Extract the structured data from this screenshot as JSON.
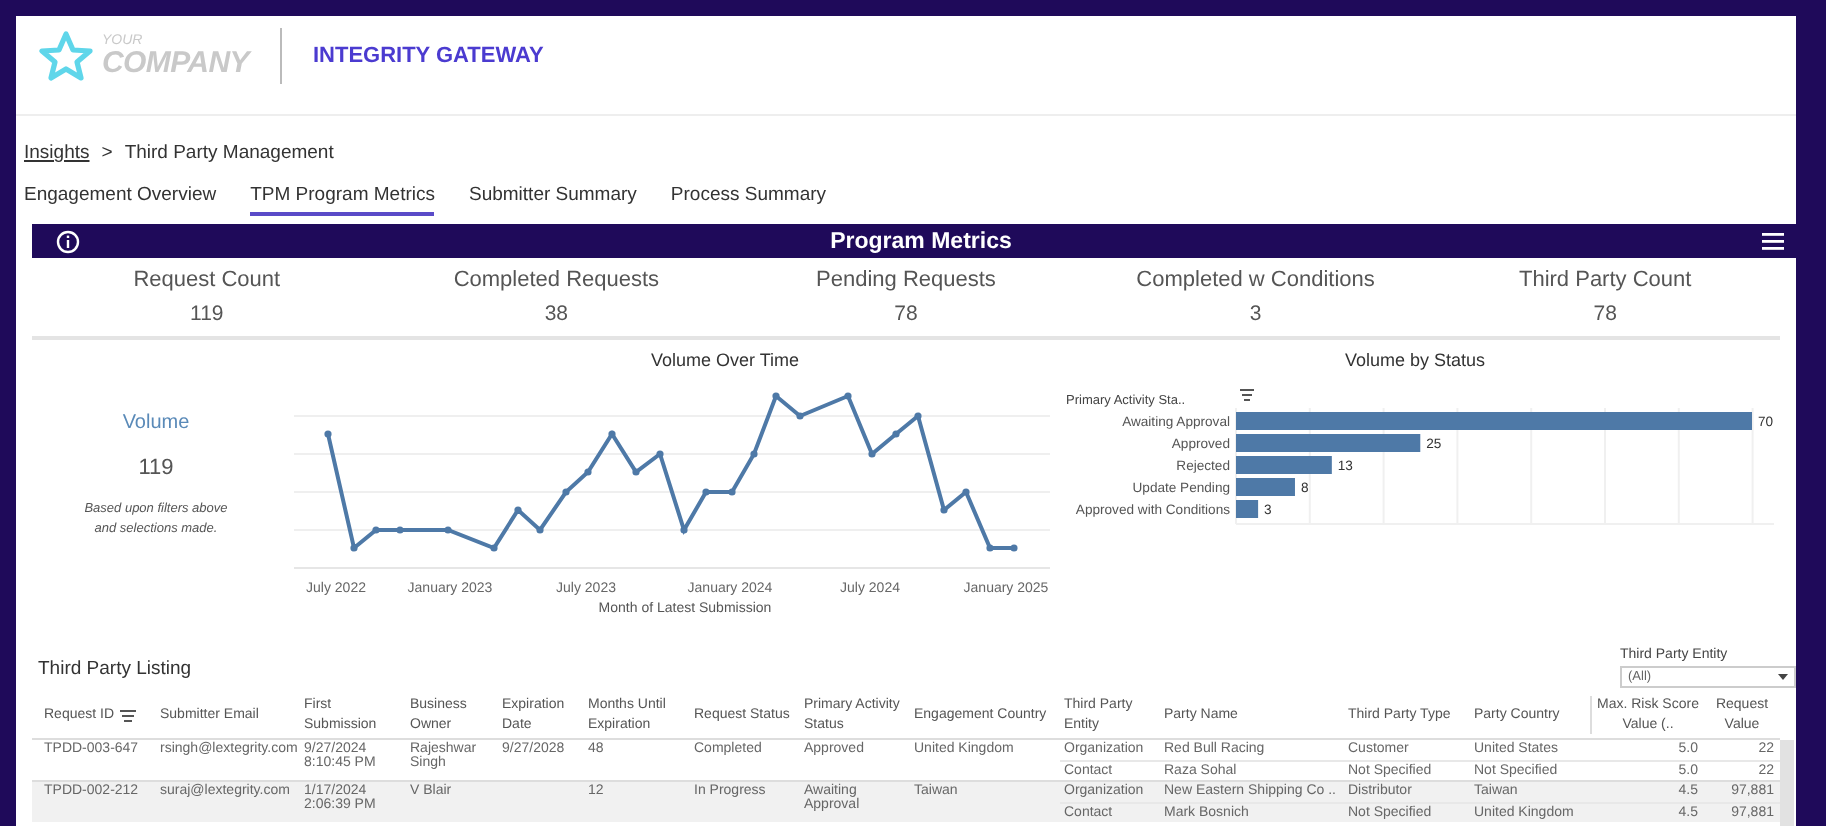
{
  "header": {
    "logo_top": "YOUR",
    "logo_bottom": "COMPANY",
    "title": "INTEGRITY GATEWAY"
  },
  "breadcrumb": {
    "link": "Insights",
    "separator": ">",
    "current": "Third Party Management"
  },
  "tabs": [
    {
      "label": "Engagement Overview",
      "selected": false
    },
    {
      "label": "TPM Program Metrics",
      "selected": true
    },
    {
      "label": "Submitter Summary",
      "selected": false
    },
    {
      "label": "Process Summary",
      "selected": false
    }
  ],
  "banner": {
    "title": "Program Metrics"
  },
  "metrics": [
    {
      "label": "Request Count",
      "value": "119"
    },
    {
      "label": "Completed Requests",
      "value": "38"
    },
    {
      "label": "Pending Requests",
      "value": "78"
    },
    {
      "label": "Completed w Conditions",
      "value": "3"
    },
    {
      "label": "Third Party Count",
      "value": "78"
    }
  ],
  "volume": {
    "label": "Volume",
    "value": "119",
    "note": "Based upon filters above and selections made."
  },
  "volume_over_time": {
    "title": "Volume Over Time",
    "x_tick_labels": [
      "July 2022",
      "January 2023",
      "July 2023",
      "January 2024",
      "July 2024",
      "January 2025"
    ],
    "xlabel": "Month of Latest Submission"
  },
  "volume_by_status": {
    "title": "Volume by Status",
    "axis_label": "Primary Activity Sta..",
    "chart_data": {
      "type": "bar",
      "orientation": "horizontal",
      "categories": [
        "Awaiting Approval",
        "Approved",
        "Rejected",
        "Update Pending",
        "Approved with Conditions"
      ],
      "values": [
        70,
        25,
        13,
        8,
        3
      ],
      "data_labels": true
    }
  },
  "listing": {
    "title": "Third Party Listing",
    "filter": {
      "label": "Third Party Entity",
      "value": "(All)"
    },
    "columns": [
      "Request ID",
      "Submitter Email",
      "First Submission",
      "Business Owner",
      "Expiration Date",
      "Months Until Expiration",
      "Request Status",
      "Primary Activity Status",
      "Engagement Country",
      "Third Party Entity",
      "Party Name",
      "Third Party Type",
      "Party Country",
      "Max. Risk Score Value (..",
      "Request Value"
    ],
    "requests": [
      {
        "request_id": "TPDD-003-647",
        "email": "rsingh@lextegrity.com",
        "first_submission": "9/27/2024 8:10:45 PM",
        "business_owner": "Rajeshwar Singh",
        "expiration_date": "9/27/2028",
        "months": "48",
        "request_status": "Completed",
        "activity_status": "Approved",
        "engagement_country": "United Kingdom",
        "parties": [
          {
            "entity": "Organization",
            "name": "Red Bull Racing",
            "type": "Customer",
            "country": "United States",
            "risk": "5.0",
            "value": "22"
          },
          {
            "entity": "Contact",
            "name": "Raza Sohal",
            "type": "Not Specified",
            "country": "Not Specified",
            "risk": "5.0",
            "value": "22"
          }
        ]
      },
      {
        "request_id": "TPDD-002-212",
        "email": "suraj@lextegrity.com",
        "first_submission": "1/17/2024 2:06:39 PM",
        "business_owner": "V Blair",
        "months": "12",
        "request_status": "In Progress",
        "activity_status": "Awaiting Approval",
        "engagement_country": "Taiwan",
        "parties": [
          {
            "entity": "Organization",
            "name": "New Eastern Shipping Co ..",
            "type": "Distributor",
            "country": "Taiwan",
            "risk": "4.5",
            "value": "97,881"
          },
          {
            "entity": "Contact",
            "name": "Mark Bosnich",
            "type": "Not Specified",
            "country": "United Kingdom",
            "risk": "4.5",
            "value": "97,881"
          }
        ]
      }
    ]
  }
}
